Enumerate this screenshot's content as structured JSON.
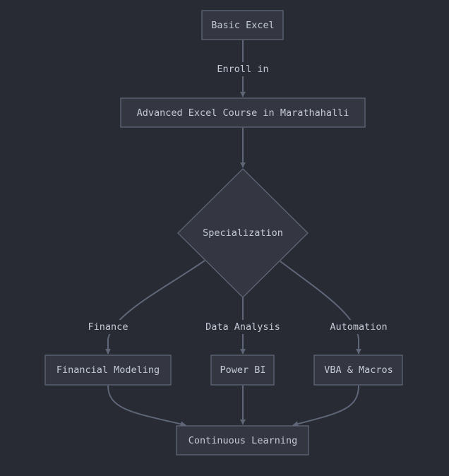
{
  "diagram": {
    "type": "flowchart",
    "colors": {
      "background": "#282b33",
      "node_fill": "#343741",
      "stroke": "#5f6678",
      "text": "#c3c9d6"
    },
    "nodes": {
      "basic": "Basic Excel",
      "advanced": "Advanced Excel Course in Marathahalli",
      "specialization": "Specialization",
      "financial": "Financial Modeling",
      "powerbi": "Power BI",
      "vba": "VBA & Macros",
      "continuous": "Continuous Learning"
    },
    "edges": [
      {
        "from": "basic",
        "to": "advanced",
        "label": "Enroll in"
      },
      {
        "from": "advanced",
        "to": "specialization",
        "label": ""
      },
      {
        "from": "specialization",
        "to": "financial",
        "label": "Finance"
      },
      {
        "from": "specialization",
        "to": "powerbi",
        "label": "Data Analysis"
      },
      {
        "from": "specialization",
        "to": "vba",
        "label": "Automation"
      },
      {
        "from": "financial",
        "to": "continuous",
        "label": ""
      },
      {
        "from": "powerbi",
        "to": "continuous",
        "label": ""
      },
      {
        "from": "vba",
        "to": "continuous",
        "label": ""
      }
    ]
  }
}
